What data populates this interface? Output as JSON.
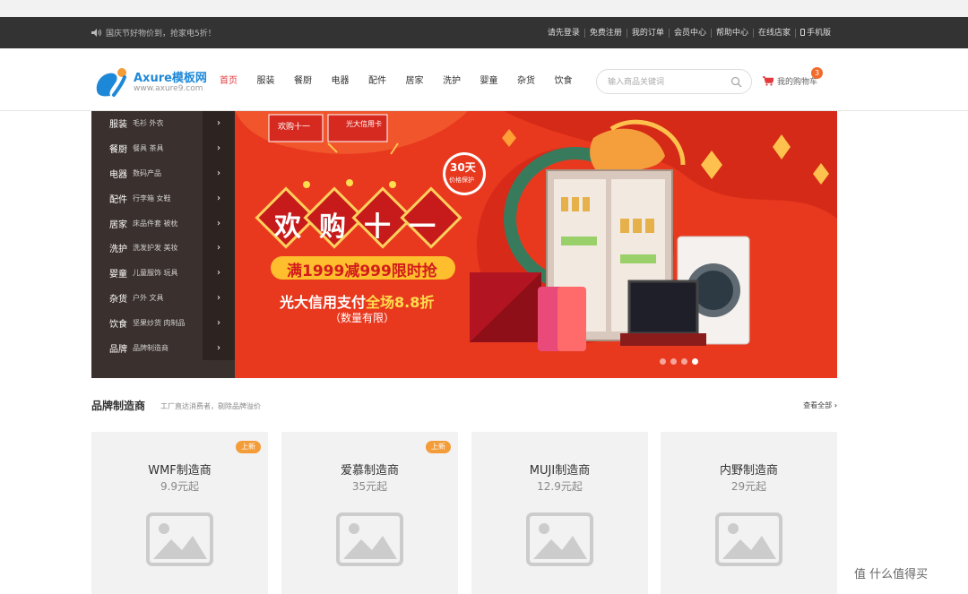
{
  "topbar": {
    "notice": "国庆节好物价到，抢家电5折！",
    "links": [
      "请先登录",
      "免费注册",
      "我的订单",
      "会员中心",
      "帮助中心",
      "在线店家",
      "手机版"
    ]
  },
  "header": {
    "logo_name": "Axure模板网",
    "logo_url": "www.axure9.com",
    "nav": [
      "首页",
      "服装",
      "餐厨",
      "电器",
      "配件",
      "居家",
      "洗护",
      "婴童",
      "杂货",
      "饮食"
    ],
    "search_placeholder": "输入商品关键词",
    "cart_label": "我的购物车",
    "cart_count": "3"
  },
  "side_menu": [
    {
      "title": "服装",
      "sub": "毛衫 外衣"
    },
    {
      "title": "餐厨",
      "sub": "餐具 茶具"
    },
    {
      "title": "电器",
      "sub": "数码产品"
    },
    {
      "title": "配件",
      "sub": "行李箱 女鞋"
    },
    {
      "title": "居家",
      "sub": "床品件套 被枕"
    },
    {
      "title": "洗护",
      "sub": "洗发护发 美妆"
    },
    {
      "title": "婴童",
      "sub": "儿童服饰 玩具"
    },
    {
      "title": "杂货",
      "sub": "户外 文具"
    },
    {
      "title": "饮食",
      "sub": "坚果炒货 肉制品"
    },
    {
      "title": "品牌",
      "sub": "品牌制造商"
    }
  ],
  "banner": {
    "headline": "欢购十一",
    "offer": "满1999减999限时抢",
    "card_pay_prefix": "光大信用支付",
    "card_pay_highlight": "全场8.8折",
    "limit": "（数量有限）",
    "price_protect_days": "30天",
    "price_protect": "价格保护",
    "logo_left": "欢购十一",
    "logo_right": "光大信用卡",
    "slide_count": 4,
    "active_slide": 4
  },
  "brands": {
    "title": "品牌制造商",
    "subtitle": "工厂直达消费者，剔除品牌溢价",
    "more": "查看全部",
    "items": [
      {
        "name": "WMF制造商",
        "price": "9.9元起",
        "tag": "上新"
      },
      {
        "name": "爱慕制造商",
        "price": "35元起",
        "tag": "上新"
      },
      {
        "name": "MUJI制造商",
        "price": "12.9元起",
        "tag": ""
      },
      {
        "name": "内野制造商",
        "price": "29元起",
        "tag": ""
      }
    ]
  },
  "watermark": "值 什么值得买",
  "colors": {
    "accent": "#e4393c",
    "topbar": "#333333",
    "banner": "#e8391f",
    "menu": "#3a302d",
    "tag": "#f39c38"
  }
}
